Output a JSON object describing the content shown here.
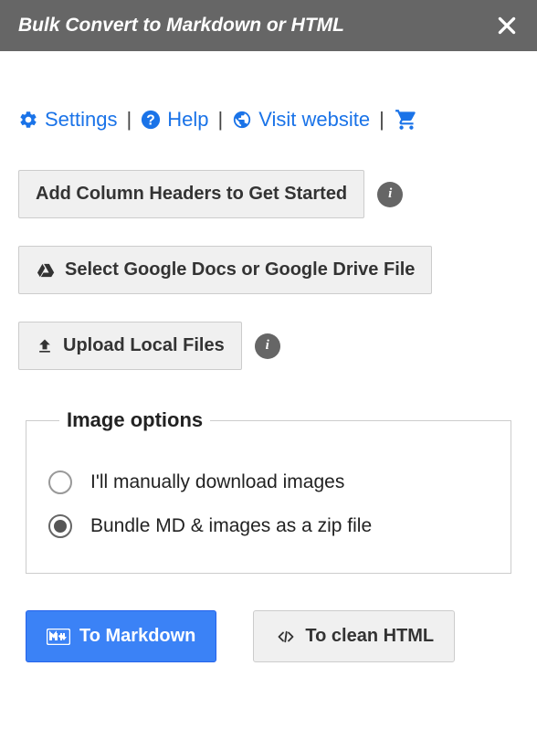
{
  "header": {
    "title": "Bulk Convert to Markdown or HTML"
  },
  "links": {
    "settings": "Settings",
    "help": "Help",
    "visit": "Visit website"
  },
  "buttons": {
    "add_headers": "Add Column Headers to Get Started",
    "select_drive": "Select Google Docs or Google Drive File",
    "upload_local": "Upload Local Files"
  },
  "image_options": {
    "legend": "Image options",
    "manual": "I'll manually download images",
    "bundle": "Bundle MD & images as a zip file"
  },
  "actions": {
    "to_markdown": "To Markdown",
    "to_html": "To clean HTML"
  }
}
